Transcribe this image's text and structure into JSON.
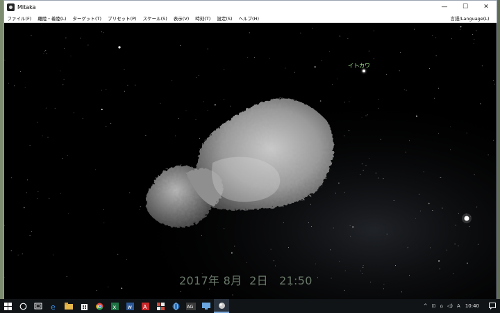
{
  "window": {
    "title": "Mitaka",
    "controls": {
      "minimize": "—",
      "maximize": "☐",
      "close": "✕"
    }
  },
  "menu": {
    "items": [
      "ファイル(F)",
      "離陸・着陸(L)",
      "ターゲット(T)",
      "プリセット(P)",
      "スケール(S)",
      "表示(V)",
      "時刻(T)",
      "設定(S)",
      "ヘルプ(H)"
    ],
    "language": "言語/Language(L)"
  },
  "viewport": {
    "target_label": "イトカワ",
    "datetime": "2017年 8月  2日   21:50"
  },
  "taskbar": {
    "icons": [
      "windows-start-icon",
      "cortana-icon",
      "task-view-icon",
      "edge-icon",
      "file-explorer-icon",
      "store-icon",
      "chrome-icon",
      "excel-icon",
      "word-icon",
      "acrobat-icon",
      "app-grid-icon",
      "browser-icon",
      "ag-icon",
      "screen-icon",
      "mitaka-icon"
    ],
    "ag_label": "AG",
    "tray": {
      "up": "^",
      "network": "⊡",
      "message": "⌂",
      "volume": "◁)",
      "ime": "A"
    },
    "clock": "10:40"
  }
}
